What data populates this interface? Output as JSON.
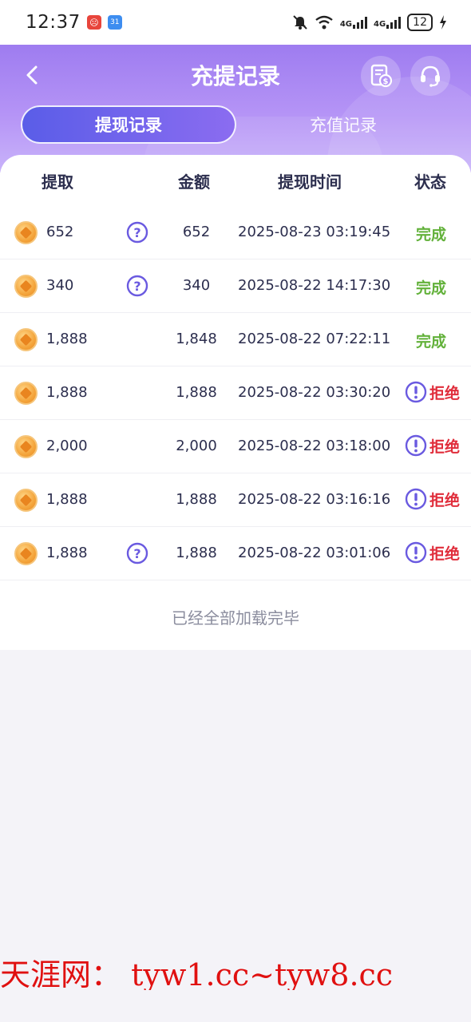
{
  "status_bar": {
    "time": "12:37",
    "app_badge_2": "31",
    "net_label_1": "4G",
    "net_label_2": "4G",
    "battery": "12"
  },
  "header": {
    "title": "充提记录",
    "tabs": [
      {
        "label": "提现记录",
        "active": true
      },
      {
        "label": "充值记录",
        "active": false
      }
    ]
  },
  "table": {
    "columns": [
      "提取",
      "金额",
      "提现时间",
      "状态"
    ],
    "rows": [
      {
        "amount": "652",
        "has_help": true,
        "value": "652",
        "time": "2025-08-23 03:19:45",
        "status": "完成",
        "status_type": "ok"
      },
      {
        "amount": "340",
        "has_help": true,
        "value": "340",
        "time": "2025-08-22 14:17:30",
        "status": "完成",
        "status_type": "ok"
      },
      {
        "amount": "1,888",
        "has_help": false,
        "value": "1,848",
        "time": "2025-08-22 07:22:11",
        "status": "完成",
        "status_type": "ok"
      },
      {
        "amount": "1,888",
        "has_help": false,
        "value": "1,888",
        "time": "2025-08-22 03:30:20",
        "status": "拒绝",
        "status_type": "rejected"
      },
      {
        "amount": "2,000",
        "has_help": false,
        "value": "2,000",
        "time": "2025-08-22 03:18:00",
        "status": "拒绝",
        "status_type": "rejected"
      },
      {
        "amount": "1,888",
        "has_help": false,
        "value": "1,888",
        "time": "2025-08-22 03:16:16",
        "status": "拒绝",
        "status_type": "rejected"
      },
      {
        "amount": "1,888",
        "has_help": true,
        "value": "1,888",
        "time": "2025-08-22 03:01:06",
        "status": "拒绝",
        "status_type": "rejected"
      }
    ],
    "end_message": "已经全部加载完毕"
  },
  "watermark": "天涯网： tyw1.cc~tyw8.cc",
  "colors": {
    "accent": "#9e7cf0",
    "tab_active": "#5a5de8",
    "status_ok": "#62b13a",
    "status_rejected": "#e02d3b",
    "icon_purple": "#6a5ae0"
  }
}
